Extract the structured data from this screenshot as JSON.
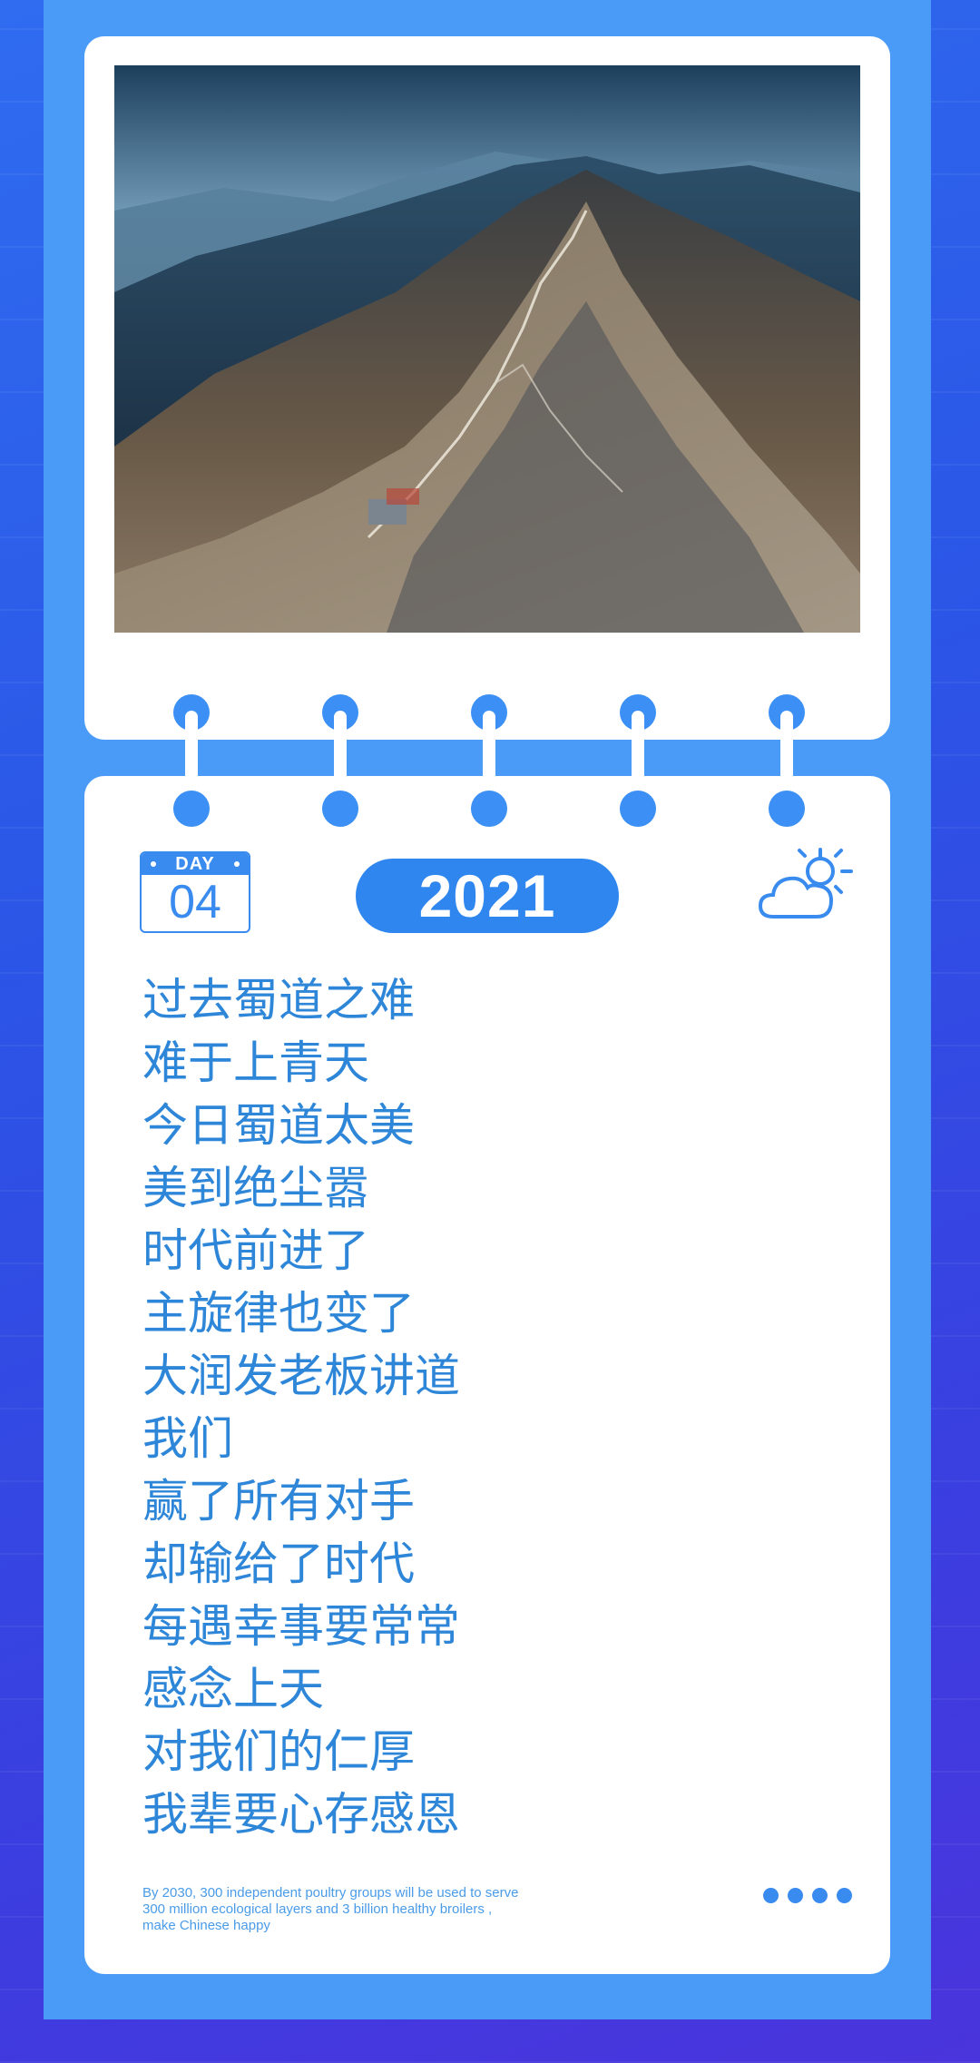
{
  "calendar": {
    "day_label": "DAY",
    "day_number": "04",
    "year": "2021"
  },
  "icons": {
    "weather": "sun-behind-cloud-icon"
  },
  "photo": {
    "subject": "mountain-ridge-photo"
  },
  "poem": {
    "lines": [
      "过去蜀道之难",
      "难于上青天",
      "今日蜀道太美",
      "美到绝尘嚣",
      "时代前进了",
      "主旋律也变了",
      "大润发老板讲道",
      "我们",
      "赢了所有对手",
      "却输给了时代",
      "每遇幸事要常常",
      "感念上天",
      "对我们的仁厚",
      "我辈要心存感恩"
    ]
  },
  "footer": {
    "text_line1": "By 2030, 300 independent poultry groups will be used to serve",
    "text_line2": "300 million ecological layers  and 3 billion healthy broilers ,",
    "text_line3": "make Chinese happy"
  },
  "colors": {
    "accent": "#3a8bef",
    "text": "#2e86d8",
    "frame": "#4a9bf7",
    "background": "#2f5ee9"
  }
}
